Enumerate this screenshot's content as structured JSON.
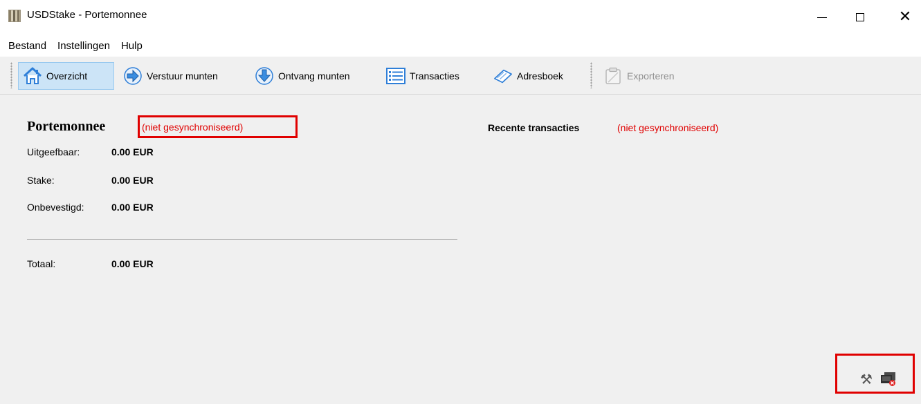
{
  "window": {
    "title": "USDStake - Portemonnee",
    "minimize_glyph": "—",
    "close_glyph": "✕"
  },
  "menu": [
    "Bestand",
    "Instellingen",
    "Hulp"
  ],
  "toolbar": {
    "overzicht": "Overzicht",
    "verstuur": "Verstuur munten",
    "ontvang": "Ontvang munten",
    "transacties": "Transacties",
    "adresboek": "Adresboek",
    "exporteren": "Exporteren"
  },
  "wallet": {
    "title": "Portemonnee",
    "sync_status": "(niet gesynchroniseerd)",
    "spendable_label": "Uitgeefbaar:",
    "spendable_value": "0.00 EUR",
    "stake_label": "Stake:",
    "stake_value": "0.00 EUR",
    "unconfirmed_label": "Onbevestigd:",
    "unconfirmed_value": "0.00 EUR",
    "total_label": "Totaal:",
    "total_value": "0.00 EUR"
  },
  "recent": {
    "title": "Recente transacties",
    "sync_status": "(niet gesynchroniseerd)"
  },
  "statusbar": {
    "staking_icon": "⚒"
  },
  "colors": {
    "warning": "#e00000",
    "active_button": "#cce4f7",
    "icon_blue": "#2f7fd8"
  }
}
